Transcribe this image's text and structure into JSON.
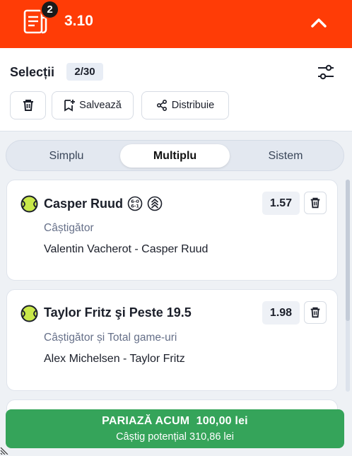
{
  "header": {
    "badge_count": "2",
    "total_odds": "3.10",
    "icons": {
      "slip": "bet-slip-icon",
      "collapse": "chevron-up-icon"
    }
  },
  "selections": {
    "title": "Selecții",
    "count": "2/30"
  },
  "actions": {
    "save_label": "Salvează",
    "share_label": "Distribuie"
  },
  "tabs": [
    {
      "label": "Simplu",
      "active": false
    },
    {
      "label": "Multiplu",
      "active": true
    },
    {
      "label": "Sistem",
      "active": false
    }
  ],
  "bets": [
    {
      "selection": "Casper Ruud",
      "market": "Câștigător",
      "event": "Valentin Vacherot - Casper Ruud",
      "odds": "1.57",
      "icons": [
        "tennis-ball-icon",
        "set-score-icon",
        "boost-icon"
      ]
    },
    {
      "selection": "Taylor Fritz şi Peste 19.5",
      "market": "Câștigător și Total game-uri",
      "event": "Alex Michelsen - Taylor Fritz",
      "odds": "1.98",
      "icons": [
        "tennis-ball-icon"
      ]
    }
  ],
  "place_bet": {
    "label": "PARIAZĂ ACUM",
    "stake": "100,00 lei",
    "potential_win": "Câștig potențial 310,86 lei"
  },
  "colors": {
    "brand": "#ff3c06",
    "bet_button": "#35a45a",
    "tennis_ball": "#c9e84a"
  }
}
